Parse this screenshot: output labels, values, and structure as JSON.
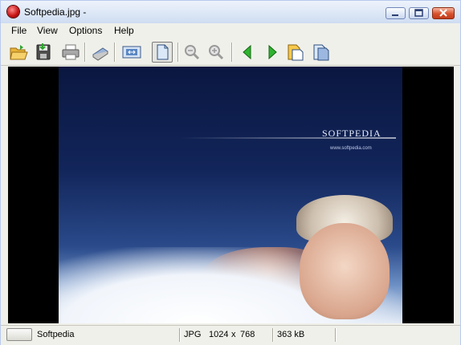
{
  "window": {
    "title": "Softpedia.jpg -",
    "controls": [
      "minimize",
      "maximize",
      "close"
    ]
  },
  "menu": {
    "items": [
      "File",
      "View",
      "Options",
      "Help"
    ]
  },
  "toolbar": {
    "buttons": [
      {
        "name": "open",
        "icon": "open-folder-icon"
      },
      {
        "name": "save",
        "icon": "save-icon"
      },
      {
        "name": "print",
        "icon": "printer-icon"
      },
      {
        "name": "scan",
        "icon": "scanner-icon"
      },
      {
        "name": "fit-window",
        "icon": "fit-window-icon"
      },
      {
        "name": "actual-size",
        "icon": "page-icon",
        "active": true
      },
      {
        "name": "zoom-out",
        "icon": "zoom-out-icon"
      },
      {
        "name": "zoom-in",
        "icon": "zoom-in-icon"
      },
      {
        "name": "previous",
        "icon": "arrow-left-icon"
      },
      {
        "name": "next",
        "icon": "arrow-right-icon"
      },
      {
        "name": "copy",
        "icon": "copy-icon"
      },
      {
        "name": "paste",
        "icon": "paste-icon"
      }
    ]
  },
  "image": {
    "logo_text": "SOFTPEDIA",
    "logo_url": "www.softpedia.com"
  },
  "status": {
    "name": "Softpedia",
    "format": "JPG",
    "width": "1024",
    "separator": "x",
    "height": "768",
    "size": "363 kB"
  },
  "colors": {
    "close_button": "#d6512c",
    "arrow_green": "#2fb32f",
    "viewport_bg": "#000000"
  }
}
